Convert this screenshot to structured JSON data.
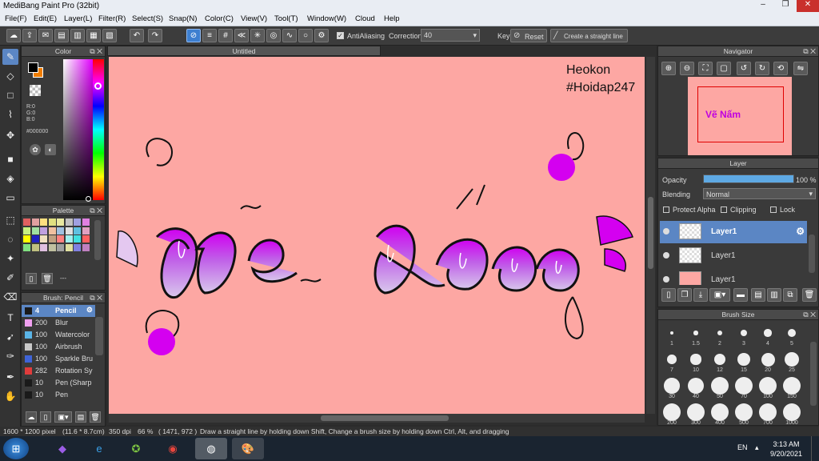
{
  "app": {
    "title": "MediBang Paint Pro (32bit)"
  },
  "menu": [
    "File(F)",
    "Edit(E)",
    "Layer(L)",
    "Filter(R)",
    "Select(S)",
    "Snap(N)",
    "Color(C)",
    "View(V)",
    "Tool(T)",
    "Window(W)",
    "Cloud",
    "Help"
  ],
  "toolbar": {
    "antialias_label": "AntiAliasing",
    "correction_label": "Correction",
    "correction_value": "40",
    "key_label": "Key",
    "reset_label": "Reset",
    "straight_line_label": "Create a straight line"
  },
  "colors": {
    "fg": "#000000",
    "bg": "#f07d00",
    "canvas": "#fda7a3",
    "accent": "#5b86c4"
  },
  "color_panel": {
    "title": "Color",
    "r": "R:0",
    "g": "G:0",
    "b": "B:0",
    "hex": "#000000"
  },
  "palette_panel": {
    "title": "Palette",
    "extra": "---"
  },
  "brush_panel": {
    "title": "Brush: Pencil",
    "items": [
      {
        "size": "4",
        "name": "Pencil",
        "color": "#1a1a1a",
        "selected": true
      },
      {
        "size": "200",
        "name": "Blur",
        "color": "#f0a0f0"
      },
      {
        "size": "100",
        "name": "Watercolor",
        "color": "#5ab4e6"
      },
      {
        "size": "100",
        "name": "Airbrush",
        "color": "#c8c8c8"
      },
      {
        "size": "100",
        "name": "Sparkle Bru",
        "color": "#3f64d8"
      },
      {
        "size": "282",
        "name": "Rotation Sy",
        "color": "#e03c3c"
      },
      {
        "size": "10",
        "name": "Pen (Sharp",
        "color": "#1a1a1a"
      },
      {
        "size": "10",
        "name": "Pen",
        "color": "#1a1a1a"
      }
    ]
  },
  "document": {
    "tab": "Untitled"
  },
  "canvas_text": {
    "line1": "Heokon",
    "line2": "#Hoidap247",
    "artwork": "Vẽ Nấm"
  },
  "navigator": {
    "title": "Navigator"
  },
  "layer_panel": {
    "title": "Layer",
    "opacity_label": "Opacity",
    "opacity_value": "100 %",
    "opacity": 1.0,
    "blending_label": "Blending",
    "blending_value": "Normal",
    "protect_alpha": "Protect Alpha",
    "clipping": "Clipping",
    "lock": "Lock",
    "layers": [
      {
        "name": "Layer1",
        "selected": true
      },
      {
        "name": "Layer1",
        "selected": false
      },
      {
        "name": "Layer1",
        "selected": false
      }
    ]
  },
  "brush_size": {
    "title": "Brush Size",
    "sizes": [
      "1",
      "1.5",
      "2",
      "3",
      "4",
      "5",
      "7",
      "10",
      "12",
      "15",
      "20",
      "25",
      "30",
      "40",
      "50",
      "70",
      "100",
      "150",
      "200",
      "300",
      "400",
      "500",
      "700",
      "1000"
    ]
  },
  "status": {
    "size": "1600 * 1200 pixel",
    "cm": "(11.6 * 8.7cm)",
    "dpi": "350 dpi",
    "zoom": "66 %",
    "coords": "( 1471, 972 )",
    "hint": "Draw a straight line by holding down Shift, Change a brush size by holding down Ctrl, Alt, and dragging"
  },
  "taskbar": {
    "lang": "EN",
    "time": "3:13 AM",
    "date": "9/20/2021"
  }
}
